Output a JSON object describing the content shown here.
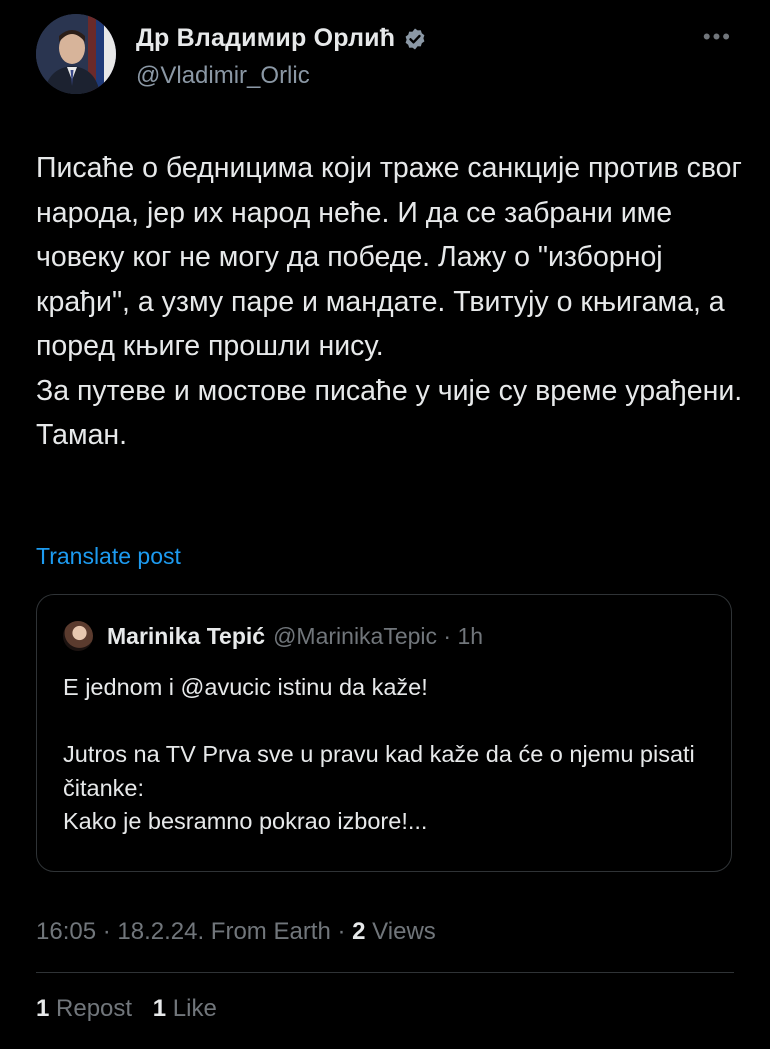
{
  "author": {
    "name": "Др Владимир Орлић",
    "handle": "@Vladimir_Orlic",
    "verified": true,
    "verified_icon": "verified-badge-icon",
    "more_icon": "more-options-icon"
  },
  "tweet": {
    "text": "Писаће о бедницима који траже санкције против свог народа, јер их народ неће. И да се забрани име човеку ког не могу да победе. Лажу о \"изборној крађи\", а узму паре и мандате. Твитују о књигама, а поред књиге прошли нису.\nЗа путеве и мостове писаће у чије су време урађени. Таман.",
    "translate_label": "Translate post"
  },
  "quote": {
    "name": "Marinika Tepić",
    "handle_time": "@MarinikaTepic · 1h",
    "text": "E jednom i @avucic istinu da kaže!\n\nJutros na TV Prva sve u pravu kad kaže da će o njemu pisati čitanke:\nKako je besramno pokrao izbore!..."
  },
  "meta": {
    "time_date_source": "16:05 · 18.2.24. From Earth · ",
    "views_count": "2",
    "views_label": " Views"
  },
  "stats": {
    "reposts_count": "1",
    "reposts_label": "Repost",
    "likes_count": "1",
    "likes_label": "Like"
  },
  "colors": {
    "background": "#000000",
    "text": "#e7e9ea",
    "muted": "#71767b",
    "link": "#1d9bf0",
    "verified": "#8b98a5",
    "border": "#2f3336"
  }
}
